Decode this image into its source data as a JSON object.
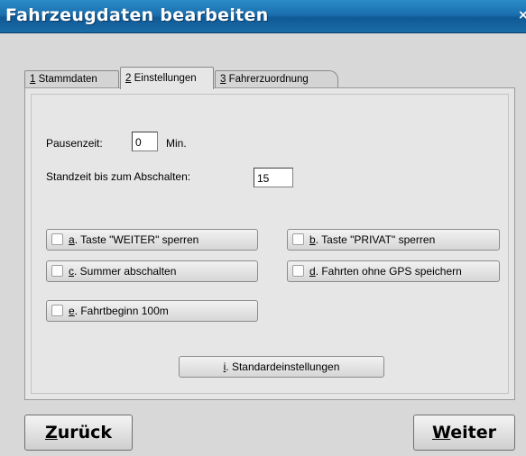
{
  "window": {
    "title": "Fahrzeugdaten bearbeiten",
    "close_label": "×"
  },
  "tabs": [
    {
      "key": "1",
      "label": " Stammdaten"
    },
    {
      "key": "2",
      "label": " Einstellungen"
    },
    {
      "key": "3",
      "label": " Fahrerzuordnung"
    }
  ],
  "active_tab": "2 Einstellungen",
  "fields": {
    "pausenzeit_label": "Pausenzeit:",
    "pausenzeit_value": "0",
    "pausenzeit_unit": "Min.",
    "standzeit_label": "Standzeit bis zum Abschalten:",
    "standzeit_value": "15"
  },
  "options": [
    {
      "key": "a",
      "label": ". Taste \"WEITER\" sperren",
      "checked": false
    },
    {
      "key": "b",
      "label": ". Taste \"PRIVAT\" sperren",
      "checked": false
    },
    {
      "key": "c",
      "label": ". Summer abschalten",
      "checked": false
    },
    {
      "key": "d",
      "label": ". Fahrten ohne GPS speichern",
      "checked": false
    },
    {
      "key": "e",
      "label": ". Fahrtbeginn 100m",
      "checked": false
    }
  ],
  "defaults_button": {
    "key": "i",
    "label": ". Standardeinstellungen"
  },
  "nav": {
    "back_key": "Z",
    "back_rest": "urück",
    "next_key": "W",
    "next_rest": "eiter"
  }
}
